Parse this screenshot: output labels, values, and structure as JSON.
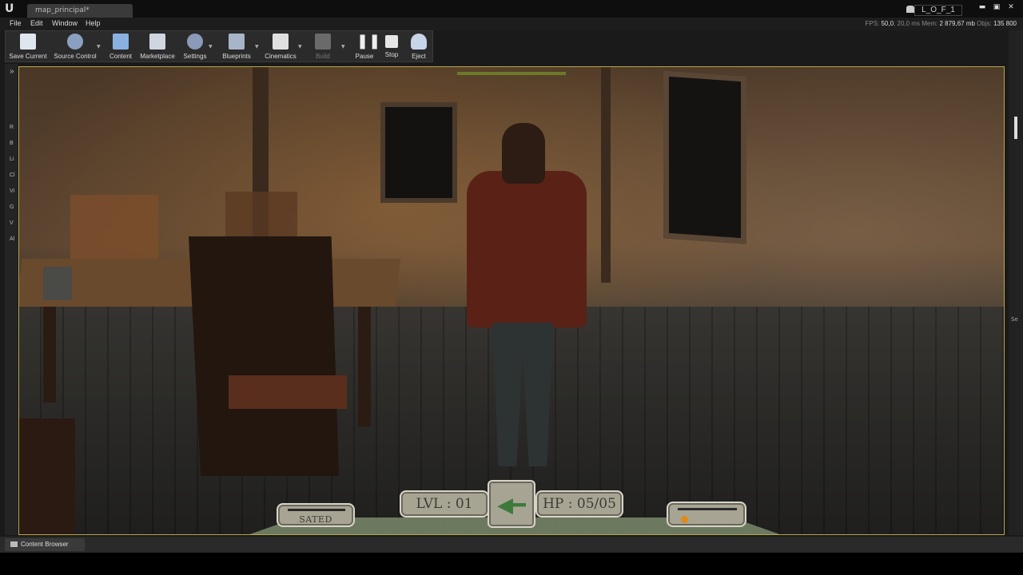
{
  "titlebar": {
    "tab_label": "map_principal*",
    "project_name": "L_O_F_1",
    "controls": [
      "▬",
      "▣",
      "✕"
    ]
  },
  "menu": {
    "items": [
      "File",
      "Edit",
      "Window",
      "Help"
    ]
  },
  "stats": {
    "fps_label": "FPS:",
    "fps_value": "50,0",
    "ms_value": "20,0 ms",
    "mem_label": "Mem:",
    "mem_value": "2 879,67 mb",
    "objs_label": "Objs:",
    "objs_value": "135 800"
  },
  "toolbar": {
    "save_current": "Save Current",
    "source_control": "Source Control",
    "content": "Content",
    "marketplace": "Marketplace",
    "settings": "Settings",
    "blueprints": "Blueprints",
    "cinematics": "Cinematics",
    "build": "Build",
    "pause": "Pause",
    "stop": "Stop",
    "eject": "Eject"
  },
  "left_strip": {
    "items": [
      "R",
      "B",
      "Li",
      "Cl",
      "Vi",
      "G",
      "V",
      "Al"
    ]
  },
  "right_panel": {
    "label": "Se"
  },
  "hud": {
    "sated": "SATED",
    "level": "LVL : 01",
    "hp": "HP : 05/05",
    "accent_green": "#3d7a3a",
    "accent_orange": "#e08a1a"
  },
  "bottom": {
    "content_browser": "Content Browser"
  },
  "colors": {
    "viewport_border": "#b8a64a",
    "editor_bg": "#1a1a1a"
  }
}
